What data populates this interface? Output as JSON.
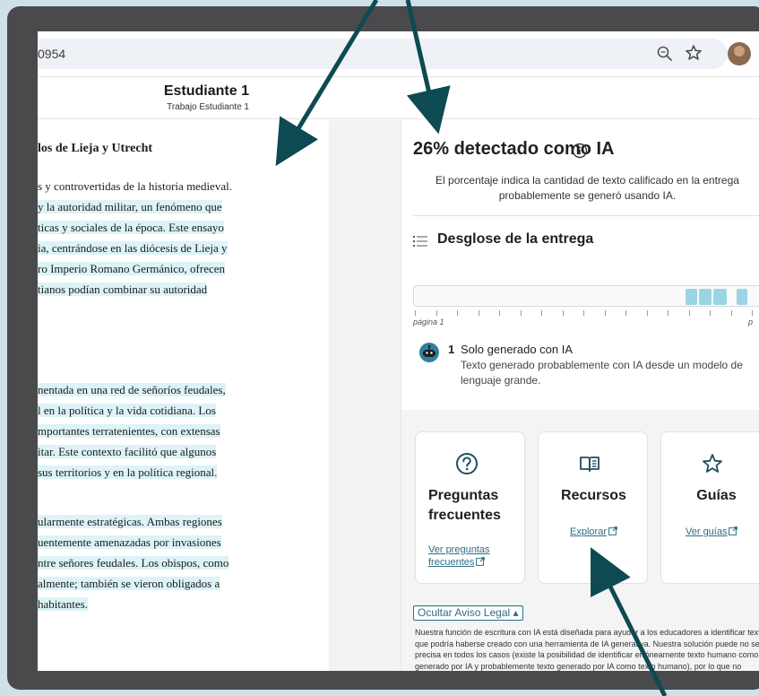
{
  "browser": {
    "url": "0954"
  },
  "header": {
    "student_name": "Estudiante 1",
    "submission_title": "Trabajo Estudiante 1"
  },
  "document": {
    "title": "los de Lieja y Utrecht",
    "paragraphs": [
      [
        {
          "text": "s y controvertidas de la historia medieval.",
          "hl": false
        },
        {
          "text": "y la autoridad militar, un fenómeno que",
          "hl": true
        },
        {
          "text": "ticas y sociales de la época. Este ensayo",
          "hl": true
        },
        {
          "text": "ia, centrándose en las diócesis de Lieja y",
          "hl": true
        },
        {
          "text": "ro Imperio Romano Germánico, ofrecen",
          "hl": true
        },
        {
          "text": "tianos podían combinar su autoridad",
          "hl": true
        }
      ],
      [
        {
          "text": "nentada en una red de señoríos feudales,",
          "hl": true
        },
        {
          "text": "l en la política y la vida cotidiana. Los",
          "hl": true
        },
        {
          "text": "mportantes terratenientes, con extensas",
          "hl": true
        },
        {
          "text": "itar. Este contexto facilitó que algunos",
          "hl": true
        },
        {
          "text": "sus territorios y en la política regional.",
          "hl": true
        }
      ],
      [
        {
          "text": "ularmente estratégicas. Ambas regiones",
          "hl": true
        },
        {
          "text": "uentemente amenazadas por invasiones",
          "hl": true
        },
        {
          "text": "ntre señores feudales. Los obispos, como",
          "hl": true
        },
        {
          "text": "almente; también se vieron obligados a",
          "hl": true
        },
        {
          "text": "habitantes.",
          "hl": true
        }
      ]
    ]
  },
  "panel": {
    "detected_title": "26% detectado como IA",
    "detected_description": "El porcentaje indica la cantidad de texto calificado en la entrega probablemente se generó usando IA.",
    "breakdown_title": "Desglose de la entrega",
    "page_start_label": "página 1",
    "page_end_label": "p",
    "breakdown_segments": [
      {
        "start": 0.757,
        "end": 0.79
      },
      {
        "start": 0.795,
        "end": 0.83
      },
      {
        "start": 0.835,
        "end": 0.872
      },
      {
        "start": 0.9,
        "end": 0.93
      }
    ],
    "ai_only": {
      "count": "1",
      "label": "Solo generado con IA",
      "description": "Texto generado probablemente con IA desde un modelo de lenguaje grande."
    },
    "cards": [
      {
        "title": "Preguntas frecuentes",
        "link": "Ver preguntas frecuentes",
        "icon": "question-circle-icon"
      },
      {
        "title": "Recursos",
        "link": "Explorar",
        "icon": "book-icon"
      },
      {
        "title": "Guías",
        "link": "Ver guías",
        "icon": "star-outline-icon"
      }
    ],
    "legal_toggle": "Ocultar Aviso Legal ▴",
    "legal_text": "Nuestra función de escritura con IA está diseñada para ayudar a los educadores a identificar texto que podría haberse creado con una herramienta de IA generativa. Nuestra solución puede no ser precisa en todos los casos (existe la posibilidad de identificar erróneamente texto humano como generado por IA y probablemente texto generado por IA como texto humano), por lo que no debería usarse como la única prueba para tomar acciones decisivas contra un estudiante. Se necesita de un"
  },
  "colors": {
    "highlight": "#dcf3f7",
    "segment": "#9bd4e4",
    "link": "#2f6e84",
    "arrow": "#0d4a52",
    "frame": "#4a4a4c"
  }
}
